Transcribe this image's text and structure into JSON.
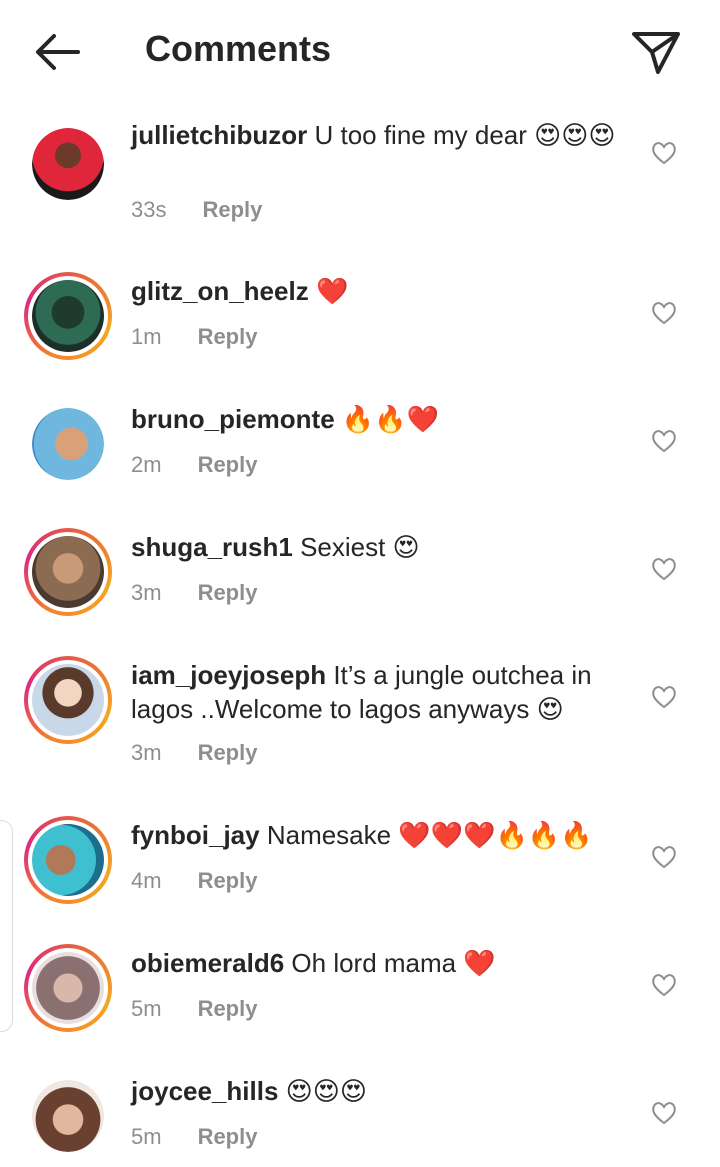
{
  "header": {
    "title": "Comments",
    "back_icon": "back-arrow-icon",
    "send_icon": "send-icon"
  },
  "reply_label": "Reply",
  "comments": [
    {
      "username": "jullietchibuzor",
      "text": "U too fine my dear 😍😍😍",
      "time": "33s"
    },
    {
      "username": "glitz_on_heelz",
      "text": "❤️",
      "time": "1m"
    },
    {
      "username": "bruno_piemonte",
      "text": "🔥🔥❤️",
      "time": "2m"
    },
    {
      "username": "shuga_rush1",
      "text": "Sexiest 😍",
      "time": "3m"
    },
    {
      "username": "iam_joeyjoseph",
      "text": "It’s a jungle outchea in lagos ..Welcome to lagos anyways 😍",
      "time": "3m"
    },
    {
      "username": "fynboi_jay",
      "text": "Namesake ❤️❤️❤️🔥🔥🔥",
      "time": "4m"
    },
    {
      "username": "obiemerald6",
      "text": "Oh lord mama ❤️",
      "time": "5m"
    },
    {
      "username": "joycee_hills",
      "text": "😍😍😍",
      "time": "5m"
    }
  ],
  "colors": {
    "text": "#262626",
    "meta": "#8e8e8e",
    "story_ring_start": "#f58529",
    "story_ring_end": "#dd2a7b"
  }
}
